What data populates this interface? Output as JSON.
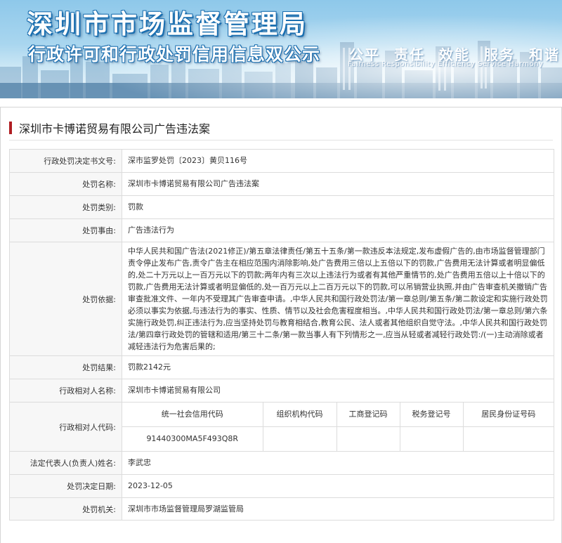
{
  "banner": {
    "title": "深圳市市场监督管理局",
    "subtitle": "行政许可和行政处罚信用信息双公示",
    "slogans": [
      "公平",
      "责任",
      "效能",
      "服务",
      "和谐"
    ],
    "slogan_en": "Fairness  Responsibility  Efficiency  Service  Harmony"
  },
  "case": {
    "title": "深圳市卡博诺贸易有限公司广告违法案"
  },
  "fields": {
    "decision_no": {
      "label": "行政处罚决定书文号:",
      "value": "深市监罗处罚〔2023〕黄贝116号"
    },
    "penalty_name": {
      "label": "处罚名称:",
      "value": "深圳市卡博诺贸易有限公司广告违法案"
    },
    "penalty_type": {
      "label": "处罚类别:",
      "value": "罚款"
    },
    "penalty_reason": {
      "label": "处罚事由:",
      "value": "广告违法行为"
    },
    "penalty_basis": {
      "label": "处罚依据:",
      "value": "中华人民共和国广告法(2021修正)/第五章法律责任/第五十五条/第一款违反本法规定,发布虚假广告的,由市场监督管理部门责令停止发布广告,责令广告主在相应范围内消除影响,处广告费用三倍以上五倍以下的罚款,广告费用无法计算或者明显偏低的,处二十万元以上一百万元以下的罚款;两年内有三次以上违法行为或者有其他严重情节的,处广告费用五倍以上十倍以下的罚款,广告费用无法计算或者明显偏低的,处一百万元以上二百万元以下的罚款,可以吊销营业执照,并由广告审查机关撤销广告审查批准文件、一年内不受理其广告审查申请。,中华人民共和国行政处罚法/第一章总则/第五条/第二款设定和实施行政处罚必须以事实为依据,与违法行为的事实、性质、情节以及社会危害程度相当。,中华人民共和国行政处罚法/第一章总则/第六条实施行政处罚,纠正违法行为,应当坚持处罚与教育相结合,教育公民、法人或者其他组织自觉守法。,中华人民共和国行政处罚法/第四章行政处罚的管辖和适用/第三十二条/第一款当事人有下列情形之一,应当从轻或者减轻行政处罚:/(一)主动消除或者减轻违法行为危害后果的;"
    },
    "penalty_result": {
      "label": "处罚结果:",
      "value": "罚款2142元"
    },
    "counterparty_name": {
      "label": "行政相对人名称:",
      "value": "深圳市卡博诺贸易有限公司"
    },
    "counterparty_code": {
      "label": "行政相对人代码:",
      "headers": [
        "统一社会信用代码",
        "组织机构代码",
        "工商登记码",
        "税务登记号",
        "居民身份证号码"
      ],
      "values": [
        "91440300MA5F493Q8R",
        "",
        "",
        "",
        ""
      ]
    },
    "legal_rep": {
      "label": "法定代表人(负责人)姓名:",
      "value": "李武忠"
    },
    "decision_date": {
      "label": "处罚决定日期:",
      "value": "2023-12-05"
    },
    "authority": {
      "label": "处罚机关:",
      "value": "深圳市市场监督管理局罗湖监管局"
    }
  },
  "colors": {
    "accent_bar": "#b01e23",
    "banner_text_stroke": "#1b6fb0",
    "label_bg": "#f7f7f7"
  }
}
